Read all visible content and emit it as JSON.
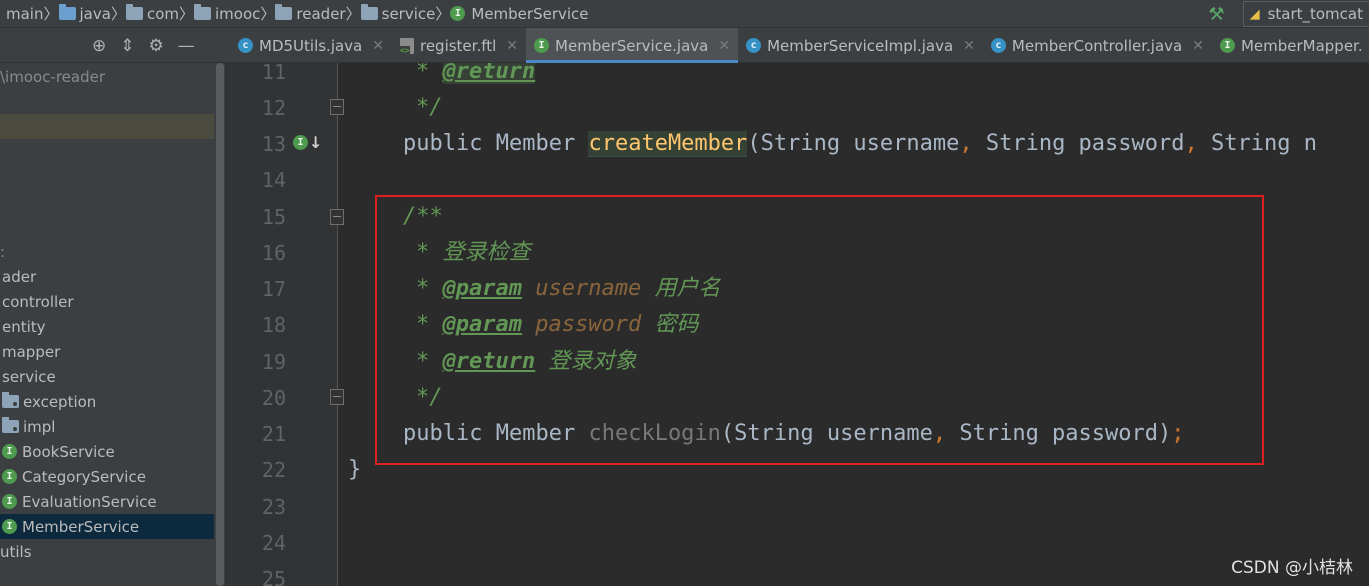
{
  "breadcrumb": {
    "items": [
      "main",
      "java",
      "com",
      "imooc",
      "reader",
      "service",
      "MemberService"
    ]
  },
  "run_config": {
    "label": "start_tomcat"
  },
  "tabs": [
    {
      "label": "MD5Utils.java",
      "kind": "class",
      "active": false
    },
    {
      "label": "register.ftl",
      "kind": "ftl",
      "active": false
    },
    {
      "label": "MemberService.java",
      "kind": "interface",
      "active": true
    },
    {
      "label": "MemberServiceImpl.java",
      "kind": "class",
      "active": false
    },
    {
      "label": "MemberController.java",
      "kind": "class",
      "active": false
    },
    {
      "label": "MemberMapper.",
      "kind": "interface",
      "active": false
    }
  ],
  "project": {
    "root": "\\imooc-reader",
    "rows": [
      {
        "label": "ader"
      },
      {
        "label": "controller"
      },
      {
        "label": "entity"
      },
      {
        "label": "mapper"
      },
      {
        "label": "service"
      },
      {
        "label": "exception"
      },
      {
        "label": "impl"
      },
      {
        "label": "BookService"
      },
      {
        "label": "CategoryService"
      },
      {
        "label": "EvaluationService"
      },
      {
        "label": "MemberService"
      },
      {
        "label": "utils"
      }
    ]
  },
  "editor": {
    "line_numbers": [
      "11",
      "12",
      "13",
      "14",
      "15",
      "16",
      "17",
      "18",
      "19",
      "20",
      "21",
      "22",
      "23",
      "24",
      "25"
    ],
    "code": {
      "l11_star": "* ",
      "l11_tag": "@return",
      "l12": "*/",
      "l13_kw": "public",
      "l13_type": "Member",
      "l13_fn": "createMember",
      "l13_args1": "(String username",
      "l13_c1": ",",
      "l13_args2": " String password",
      "l13_c2": ",",
      "l13_args3": " String n",
      "l15": "/**",
      "l16": "* 登录检查",
      "l17_tag": "@param",
      "l17_name": "username",
      "l17_desc": "用户名",
      "l18_tag": "@param",
      "l18_name": "password",
      "l18_desc": "密码",
      "l19_tag": "@return",
      "l19_desc": "登录对象",
      "l20": "*/",
      "l21_kw": "public",
      "l21_type": "Member",
      "l21_fn": "checkLogin",
      "l21_args1": "(String username",
      "l21_c1": ",",
      "l21_args2": " String password)",
      "l21_semi": ";",
      "l22": "}"
    }
  },
  "watermark": "CSDN @小桔林"
}
